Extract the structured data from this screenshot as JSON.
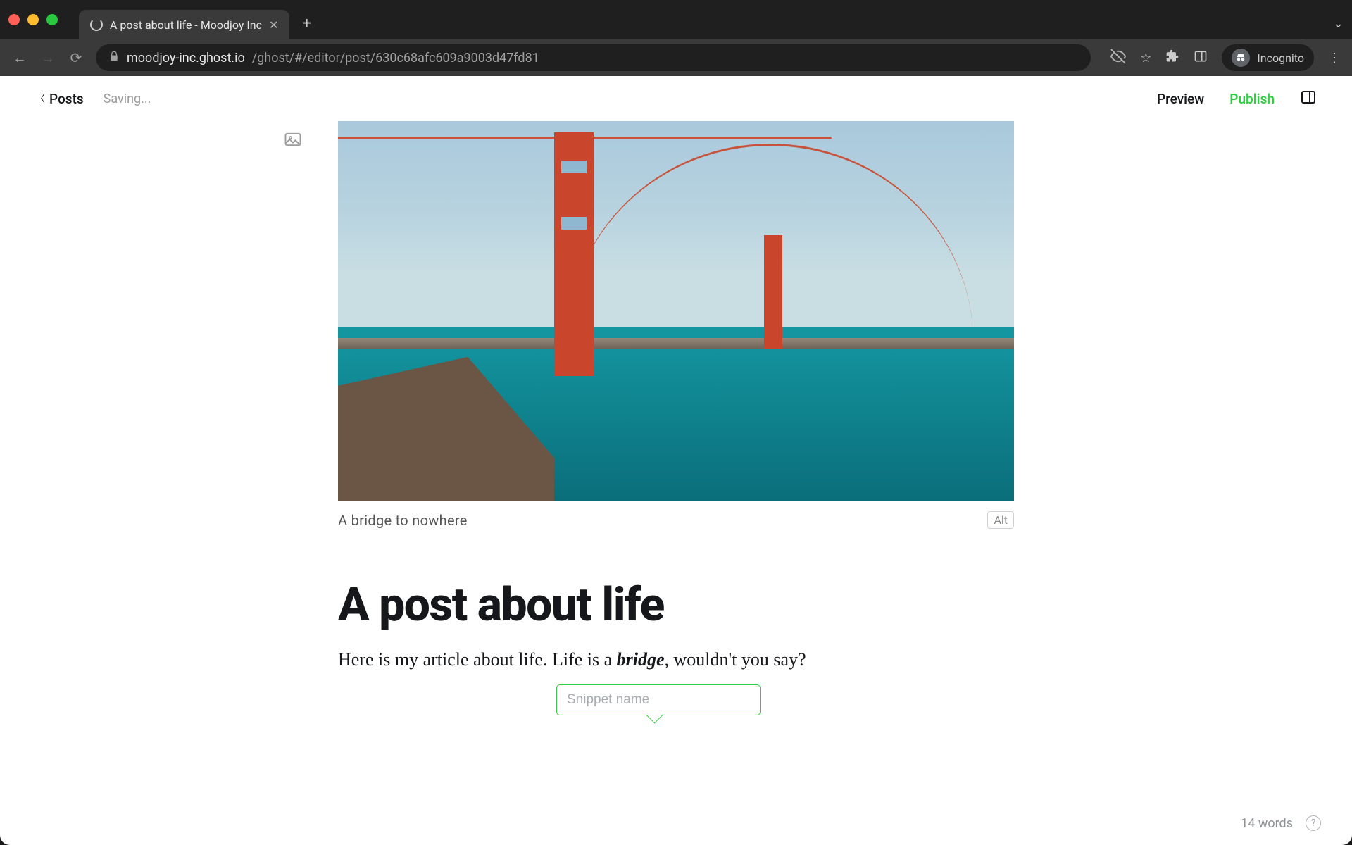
{
  "browser": {
    "tab_title": "A post about life - Moodjoy Inc",
    "url_domain": "moodjoy-inc.ghost.io",
    "url_path": "/ghost/#/editor/post/630c68afc609a9003d47fd81",
    "incognito_label": "Incognito"
  },
  "header": {
    "back_label": "Posts",
    "status": "Saving...",
    "preview_label": "Preview",
    "publish_label": "Publish"
  },
  "feature": {
    "caption": "A bridge to nowhere",
    "alt_label": "Alt"
  },
  "post": {
    "title": "A post about life",
    "body_prefix": "Here is my article about life. Life is a ",
    "body_em": "bridge",
    "body_suffix": ", wouldn't you say?"
  },
  "snippet": {
    "placeholder": "Snippet name"
  },
  "footer": {
    "word_count": "14 words"
  }
}
